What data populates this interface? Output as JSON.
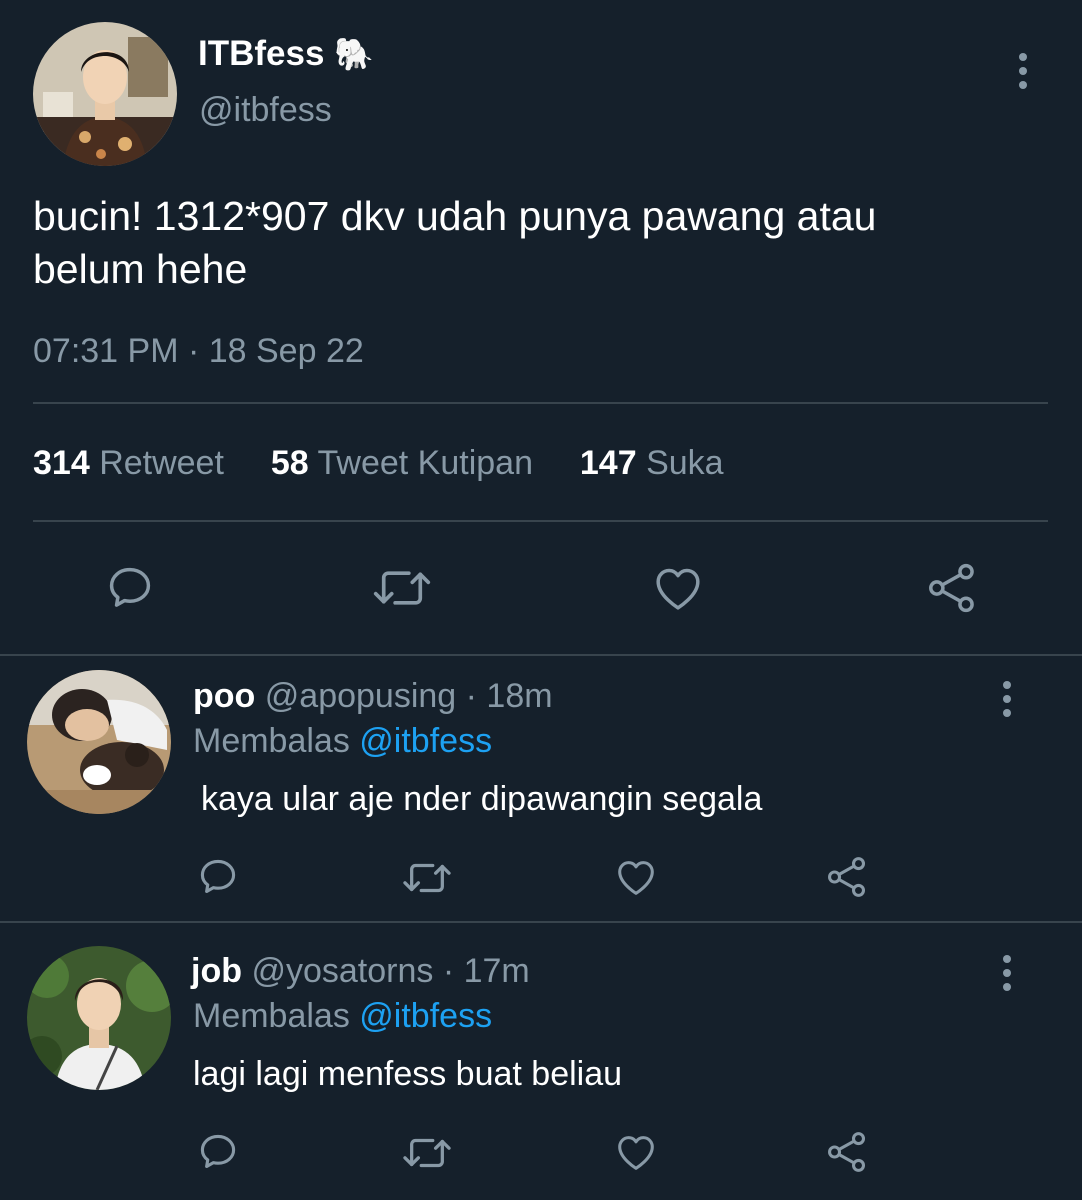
{
  "colors": {
    "background": "#15202b",
    "muted": "#8899a6",
    "link": "#1da1f2",
    "divider": "#38444d"
  },
  "tweet": {
    "display_name": "ITBfess",
    "name_emoji": "🐘",
    "handle": "@itbfess",
    "text_line1": "bucin! 1312*907 dkv udah punya pawang atau",
    "text_line2": "belum hehe",
    "timestamp": "07:31 PM · 18 Sep 22",
    "stats": {
      "retweets": "314",
      "retweets_label": "Retweet",
      "quotes": "58",
      "quotes_label": "Tweet Kutipan",
      "likes": "147",
      "likes_label": "Suka"
    },
    "menu_icon": "more-vertical-icon",
    "actions": [
      "reply-icon",
      "retweet-icon",
      "like-icon",
      "share-icon"
    ]
  },
  "replies": [
    {
      "name": "poo",
      "handle": "@apopusing",
      "time": "· 18m",
      "replying_prefix": "Membalas",
      "replying_to": "@itbfess",
      "text": "kaya ular aje nder dipawangin segala"
    },
    {
      "name": "job",
      "handle": "@yosatorns",
      "time": "· 17m",
      "replying_prefix": "Membalas",
      "replying_to": "@itbfess",
      "text": "lagi lagi menfess buat beliau"
    }
  ]
}
